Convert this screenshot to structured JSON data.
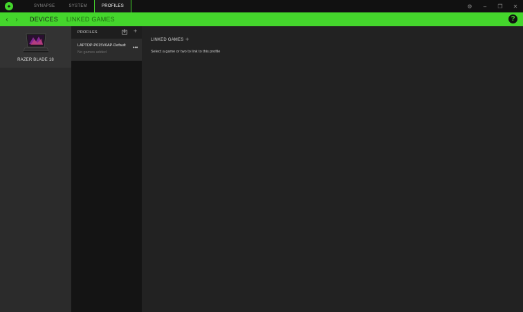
{
  "titlebar": {
    "tabs": [
      {
        "label": "SYNAPSE",
        "active": false
      },
      {
        "label": "SYSTEM",
        "active": false
      },
      {
        "label": "PROFILES",
        "active": true
      }
    ],
    "controls": {
      "settings": "⚙",
      "minimize": "–",
      "restore": "❐",
      "close": "✕"
    },
    "accent_color": "#44d62c"
  },
  "navbar": {
    "back": "‹",
    "forward": "›",
    "tabs": [
      {
        "label": "DEVICES",
        "active": true
      },
      {
        "label": "LINKED GAMES",
        "active": false
      }
    ],
    "help": "?"
  },
  "devices": {
    "items": [
      {
        "name": "RAZER BLADE 18",
        "icon": "laptop-icon"
      }
    ]
  },
  "profiles": {
    "title": "PROFILES",
    "add": "+",
    "items": [
      {
        "name": "LAPTOP-P015V0AP-Default",
        "sub": "No games added",
        "more": "•••"
      }
    ]
  },
  "linked_games": {
    "title": "LINKED GAMES",
    "add": "+",
    "description": "Select a game or two to link to this profile"
  }
}
